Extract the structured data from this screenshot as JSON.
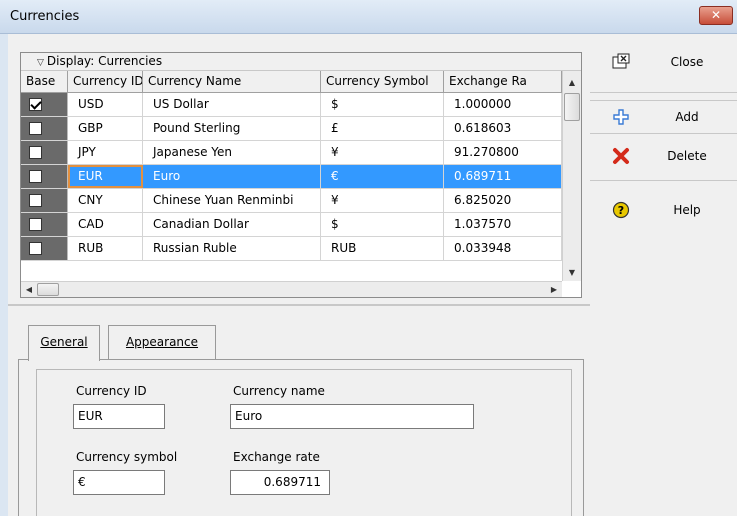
{
  "window": {
    "title": "Currencies"
  },
  "grid": {
    "caption": "Display: Currencies",
    "columns": [
      "Base",
      "Currency ID",
      "Currency Name",
      "Currency Symbol",
      "Exchange Ra"
    ],
    "rows": [
      {
        "base": true,
        "id": "USD",
        "name": "US Dollar",
        "symbol": "$",
        "rate": "1.000000"
      },
      {
        "base": false,
        "id": "GBP",
        "name": "Pound Sterling",
        "symbol": "£",
        "rate": "0.618603"
      },
      {
        "base": false,
        "id": "JPY",
        "name": "Japanese Yen",
        "symbol": "¥",
        "rate": "91.270800"
      },
      {
        "base": false,
        "id": "EUR",
        "name": "Euro",
        "symbol": "€",
        "rate": "0.689711"
      },
      {
        "base": false,
        "id": "CNY",
        "name": "Chinese Yuan Renminbi",
        "symbol": "¥",
        "rate": "6.825020"
      },
      {
        "base": false,
        "id": "CAD",
        "name": "Canadian Dollar",
        "symbol": "$",
        "rate": "1.037570"
      },
      {
        "base": false,
        "id": "RUB",
        "name": "Russian Ruble",
        "symbol": "RUB",
        "rate": "0.033948"
      }
    ],
    "selected_row": 3
  },
  "toolbar": {
    "close_label": "Close",
    "add_label": "Add",
    "delete_label": "Delete",
    "help_label": "Help"
  },
  "tabs": {
    "general_label": "General",
    "appearance_label": "Appearance"
  },
  "form": {
    "currency_id_label": "Currency ID",
    "currency_id_value": "EUR",
    "currency_name_label": "Currency name",
    "currency_name_value": "Euro",
    "currency_symbol_label": "Currency symbol",
    "currency_symbol_value": "€",
    "exchange_rate_label": "Exchange rate",
    "exchange_rate_value": "0.689711"
  },
  "colors": {
    "selection": "#3399ff",
    "focus_outline": "#e29040",
    "title_close": "#c74e3a",
    "add_icon": "#3a7bd5",
    "delete_icon": "#d42a1a",
    "help_icon": "#e8c800"
  }
}
